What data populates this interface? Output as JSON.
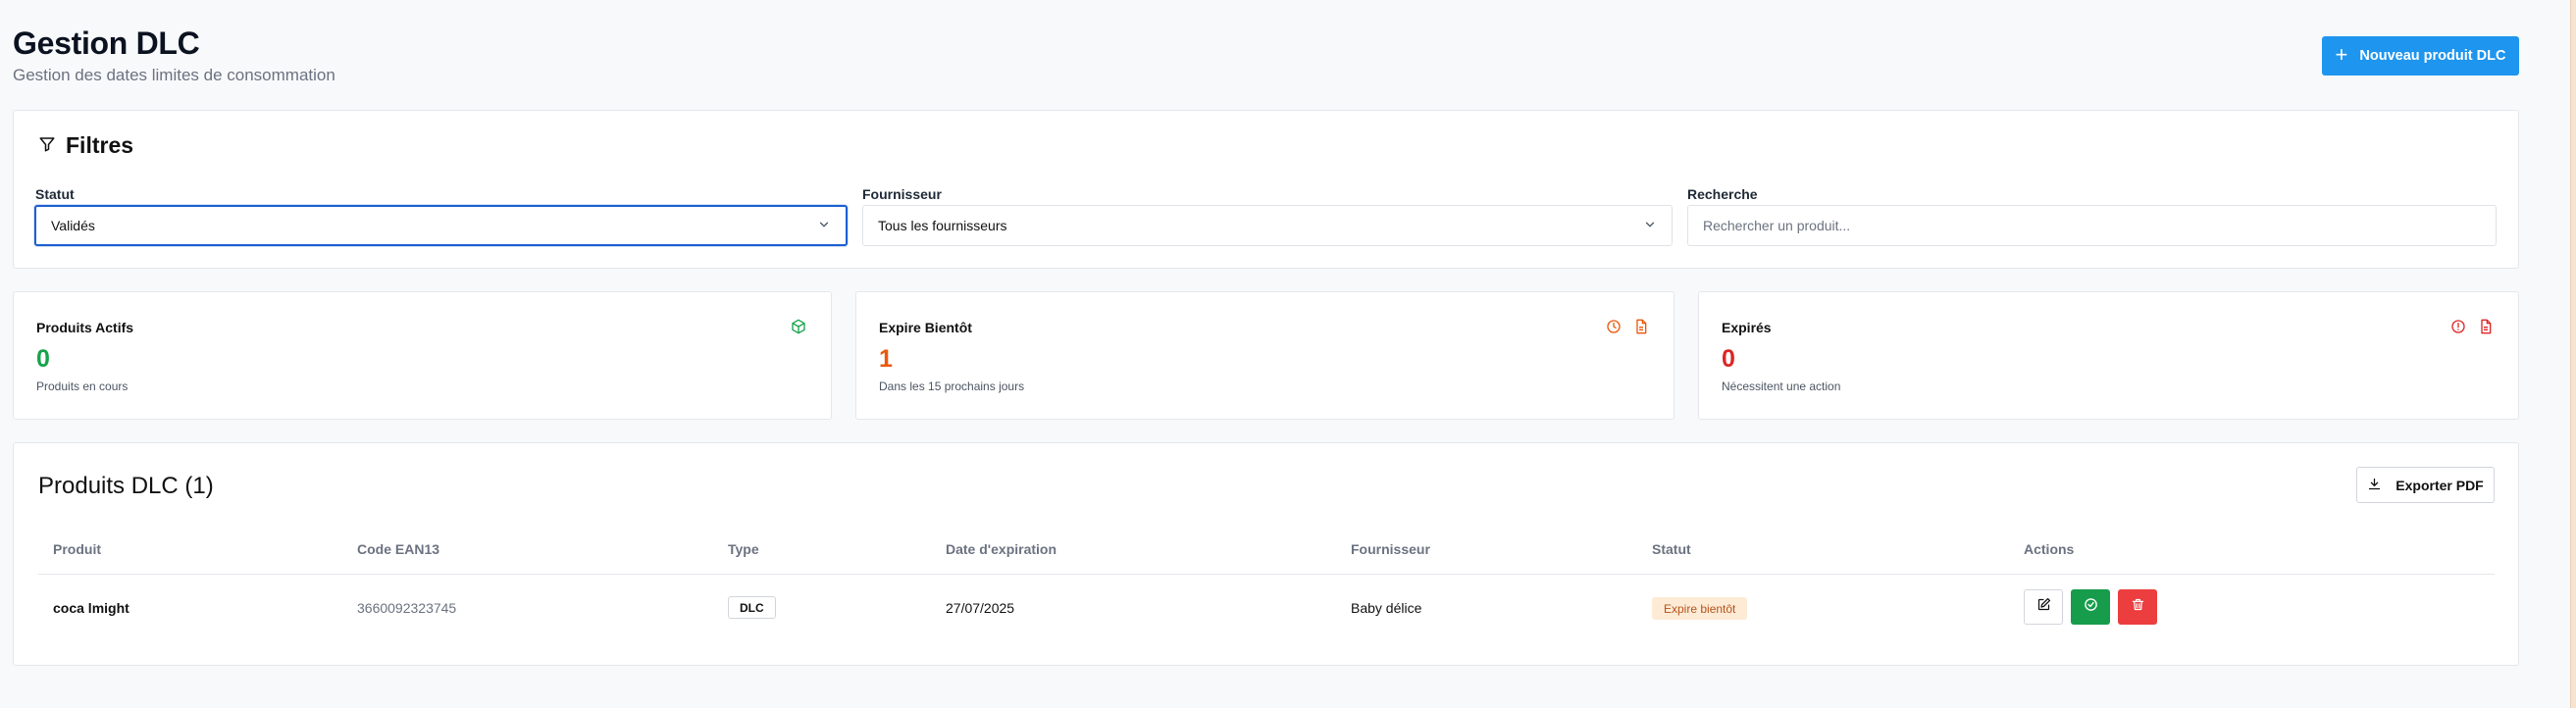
{
  "header": {
    "title": "Gestion DLC",
    "subtitle": "Gestion des dates limites de consommation",
    "new_button_label": "Nouveau produit DLC"
  },
  "filters": {
    "title": "Filtres",
    "status_label": "Statut",
    "status_value": "Validés",
    "supplier_label": "Fournisseur",
    "supplier_value": "Tous les fournisseurs",
    "search_label": "Recherche",
    "search_placeholder": "Rechercher un produit...",
    "search_value": ""
  },
  "stats": [
    {
      "title": "Produits Actifs",
      "value": "0",
      "subtitle": "Produits en cours",
      "color": "#16a34a",
      "icons": [
        "package-icon"
      ]
    },
    {
      "title": "Expire Bientôt",
      "value": "1",
      "subtitle": "Dans les 15 prochains jours",
      "color": "#ea580c",
      "icons": [
        "clock-icon",
        "document-icon"
      ]
    },
    {
      "title": "Expirés",
      "value": "0",
      "subtitle": "Nécessitent une action",
      "color": "#dc2626",
      "icons": [
        "alert-circle-icon",
        "document-icon"
      ]
    }
  ],
  "table": {
    "title": "Produits DLC (1)",
    "export_label": "Exporter PDF",
    "columns": [
      "Produit",
      "Code EAN13",
      "Type",
      "Date d'expiration",
      "Fournisseur",
      "Statut",
      "Actions"
    ],
    "rows": [
      {
        "product": "coca lmight",
        "ean": "3660092323745",
        "type": "DLC",
        "expiry": "27/07/2025",
        "supplier": "Baby délice",
        "status": "Expire bientôt",
        "actions": [
          "edit-icon",
          "check-circle-icon",
          "trash-icon"
        ]
      }
    ]
  },
  "colors": {
    "primary": "#1e95ee",
    "success": "#169c4b",
    "danger": "#ec3e3e",
    "warning_bg": "#fdebd6",
    "warning_text": "#b4531a",
    "focus": "#1d5fd1"
  }
}
